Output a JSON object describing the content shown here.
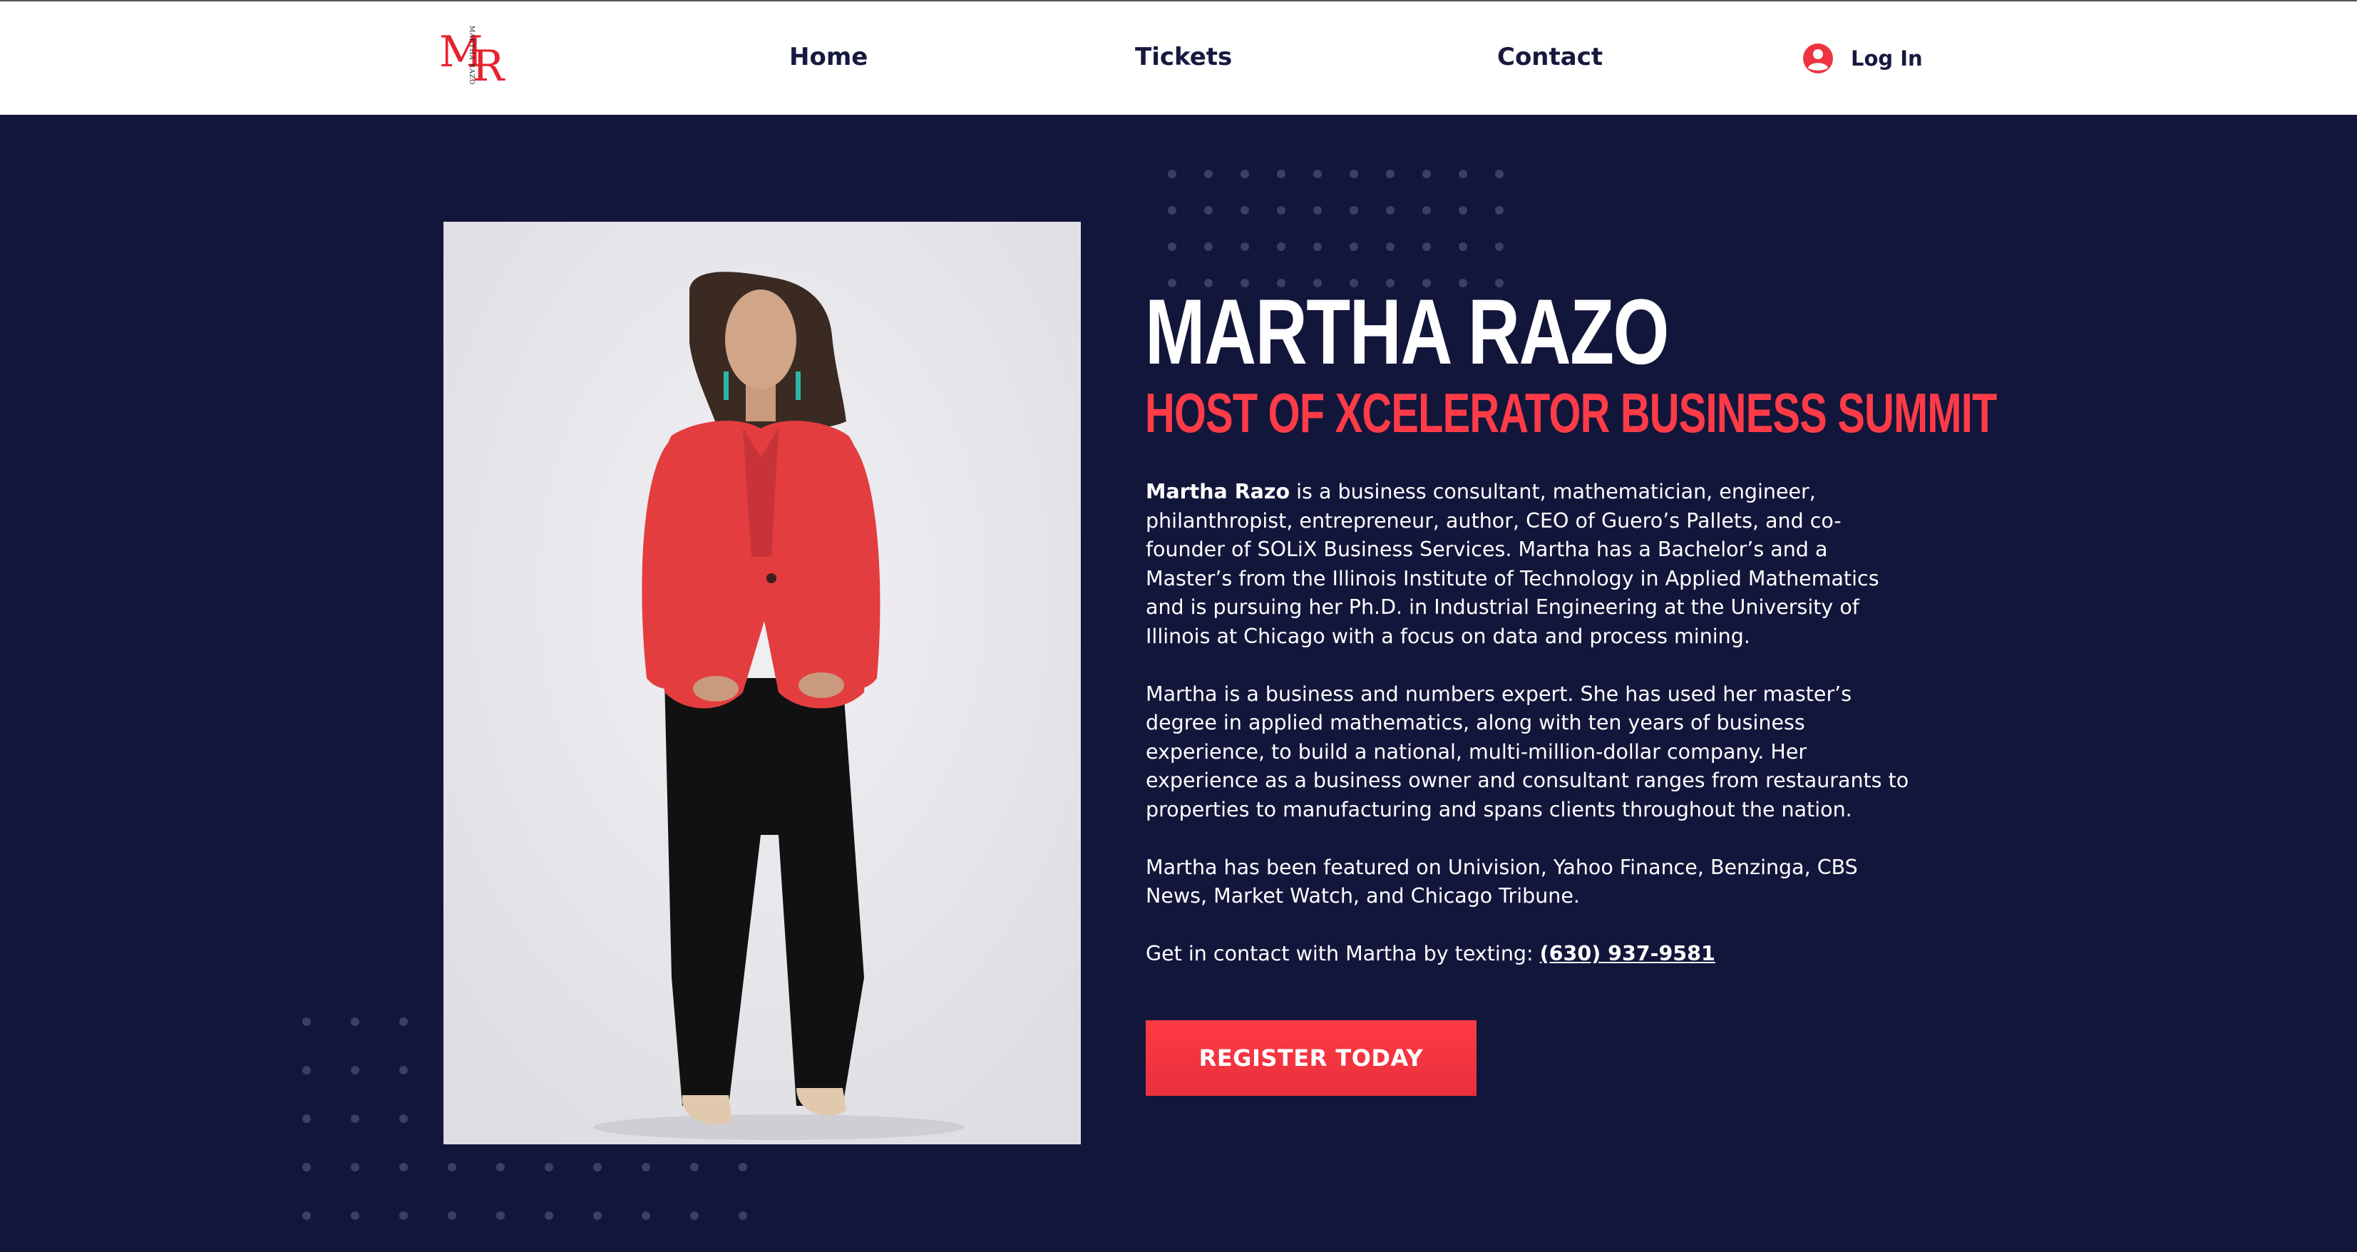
{
  "header": {
    "logo": {
      "letter_m": "M",
      "letter_r": "R",
      "vertical_text": "MARTHA RAZO"
    },
    "nav": [
      {
        "label": "Home"
      },
      {
        "label": "Tickets"
      },
      {
        "label": "Contact"
      }
    ],
    "login_label": "Log In"
  },
  "hero": {
    "name": "MARTHA RAZO",
    "subtitle": "HOST OF XCELERATOR BUSINESS SUMMIT",
    "bio": {
      "p1_name": "Martha Razo",
      "p1_rest": " is a business consultant, mathematician, engineer, philanthropist, entrepreneur, author, CEO of Guero’s Pallets, and co-founder of SOLiX Business Services. Martha has a Bachelor’s and a Master’s from the Illinois Institute of Technology in Applied Mathematics and is pursuing her Ph.D. in Industrial Engineering at the University of Illinois at Chicago with a focus on data and process mining.",
      "p2": "Martha is a business and numbers expert. She has used her master’s degree in applied mathematics, along with ten years of business experience, to build a national, multi-million-dollar company. Her experience as a business owner and consultant ranges from restaurants to properties to manufacturing and spans clients throughout the nation.",
      "p3": "Martha has been featured on Univision, Yahoo Finance, Benzinga, CBS News, Market Watch, and Chicago Tribune.",
      "p4_prefix": "Get in contact with Martha by texting: ",
      "phone": "(630) 937-9581"
    },
    "cta_label": "REGISTER TODAY"
  },
  "colors": {
    "background": "#13163b",
    "accent": "#ff3b47",
    "header_bg": "#ffffff",
    "nav_text": "#17193f"
  },
  "icons": {
    "login": "user-circle-icon"
  }
}
